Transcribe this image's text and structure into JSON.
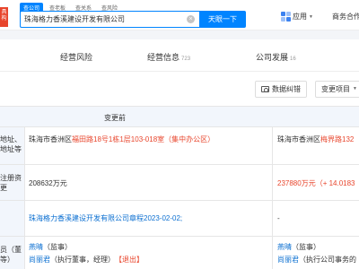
{
  "header": {
    "logo_text": "具构",
    "search_tabs": [
      "查公司",
      "查老板",
      "查关系",
      "查风险"
    ],
    "search_value": "珠海格力香溪建设开发有限公司",
    "clear_symbol": "×",
    "search_button": "天眼一下",
    "apps_label": "应用",
    "caret": "▼",
    "biz_link": "商务合作"
  },
  "nav": {
    "tabs": [
      {
        "label": "经营风险",
        "count": ""
      },
      {
        "label": "经营信息",
        "count": "723"
      },
      {
        "label": "公司发展",
        "count": "16"
      }
    ]
  },
  "toolbar": {
    "feedback_label": "数据纠错",
    "change_item_label": "变更项目",
    "caret": "▼"
  },
  "table": {
    "header_before": "变更前",
    "rows": [
      {
        "label": "地址、\n地址等",
        "before_prefix": "珠海市香洲区",
        "before_highlight": "福田路18号1栋1层103-018室（集中办公区）",
        "after_prefix": "珠海市香洲区",
        "after_highlight": "梅界路132"
      },
      {
        "label": "注册资\n更",
        "before": "208632万元",
        "after_highlight": "237880万元（+ 14.0183"
      },
      {
        "label": "",
        "before_link": "珠海格力香溪建设开发有限公司章程2023-02-02;",
        "after": "-"
      },
      {
        "label": "员（董\n等）",
        "before_line1_name": "燕晴",
        "before_line1_role": "（监事）",
        "before_line2_name": "尚丽君",
        "before_line2_role": "（执行董事，经理）",
        "before_line2_tag": "【退出】",
        "after_line1_name": "燕晴",
        "after_line1_role": "（监事）",
        "after_line2_name": "尚丽君",
        "after_line2_role": "（执行公司事务的"
      }
    ]
  },
  "colors": {
    "accent": "#0084ff",
    "highlight_red": "#e8452c",
    "link_blue": "#0b6fd1",
    "label_bg": "#f2f6fc"
  }
}
